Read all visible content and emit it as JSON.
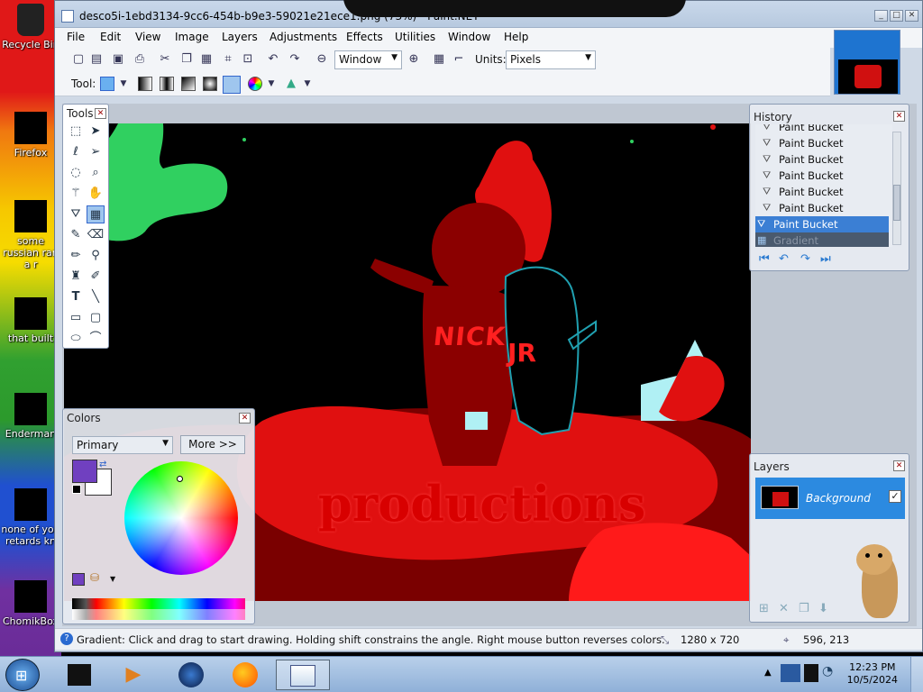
{
  "desktop": {
    "icons": [
      {
        "label": "Recycle Bin",
        "icon": "recycle-bin-icon"
      },
      {
        "label": "Firefox",
        "icon": "firefox-icon"
      },
      {
        "label": "some russian ran a r",
        "icon": "file-icon"
      },
      {
        "label": "that built",
        "icon": "file-icon"
      },
      {
        "label": "Enderman",
        "icon": "file-icon"
      },
      {
        "label": "none of you retards kn",
        "icon": "file-icon"
      },
      {
        "label": "ChomikBox",
        "icon": "hamster-icon"
      }
    ]
  },
  "window": {
    "title": "desco5i-1ebd3134-9cc6-454b-b9e3-59021e21ece1.png (73%) - Paint.NET",
    "menu": [
      "File",
      "Edit",
      "View",
      "Image",
      "Layers",
      "Adjustments",
      "Effects",
      "Utilities",
      "Window",
      "Help"
    ],
    "zoom_value": "Window",
    "units_label": "Units:",
    "units_value": "Pixels",
    "tool_label": "Tool:"
  },
  "tools_panel": {
    "title": "Tools",
    "tools": [
      "rectangle-select-icon",
      "move-selection-icon",
      "lasso-select-icon",
      "move-selected-icon",
      "ellipse-select-icon",
      "zoom-icon",
      "magic-wand-icon",
      "pan-icon",
      "paint-bucket-icon",
      "gradient-icon",
      "paintbrush-icon",
      "eraser-icon",
      "pencil-icon",
      "color-picker-icon",
      "clone-stamp-icon",
      "recolor-icon",
      "text-icon",
      "line-curve-icon",
      "rectangle-icon",
      "rounded-rectangle-icon",
      "ellipse-icon",
      "freeform-shape-icon"
    ],
    "selected_index": 9
  },
  "history_panel": {
    "title": "History",
    "items": [
      {
        "label": "Paint Bucket",
        "state": "normal"
      },
      {
        "label": "Paint Bucket",
        "state": "normal"
      },
      {
        "label": "Paint Bucket",
        "state": "normal"
      },
      {
        "label": "Paint Bucket",
        "state": "normal"
      },
      {
        "label": "Paint Bucket",
        "state": "normal"
      },
      {
        "label": "Paint Bucket",
        "state": "normal"
      },
      {
        "label": "Paint Bucket",
        "state": "selected"
      },
      {
        "label": "Gradient",
        "state": "undone"
      }
    ]
  },
  "colors_panel": {
    "title": "Colors",
    "mode": "Primary",
    "more_button": "More >>",
    "primary_color": "#7040c0",
    "secondary_color": "#ffffff"
  },
  "layers_panel": {
    "title": "Layers",
    "layers": [
      {
        "name": "Background",
        "visible": true
      }
    ]
  },
  "canvas_text": {
    "nick": "NICK",
    "jr": "JR",
    "productions": "productions"
  },
  "statusbar": {
    "hint": "Gradient: Click and drag to start drawing. Holding shift constrains the angle. Right mouse button reverses colors.",
    "image_size": "1280 x 720",
    "cursor_pos": "596, 213"
  },
  "taskbar": {
    "time": "12:23 PM",
    "date": "10/5/2024"
  }
}
